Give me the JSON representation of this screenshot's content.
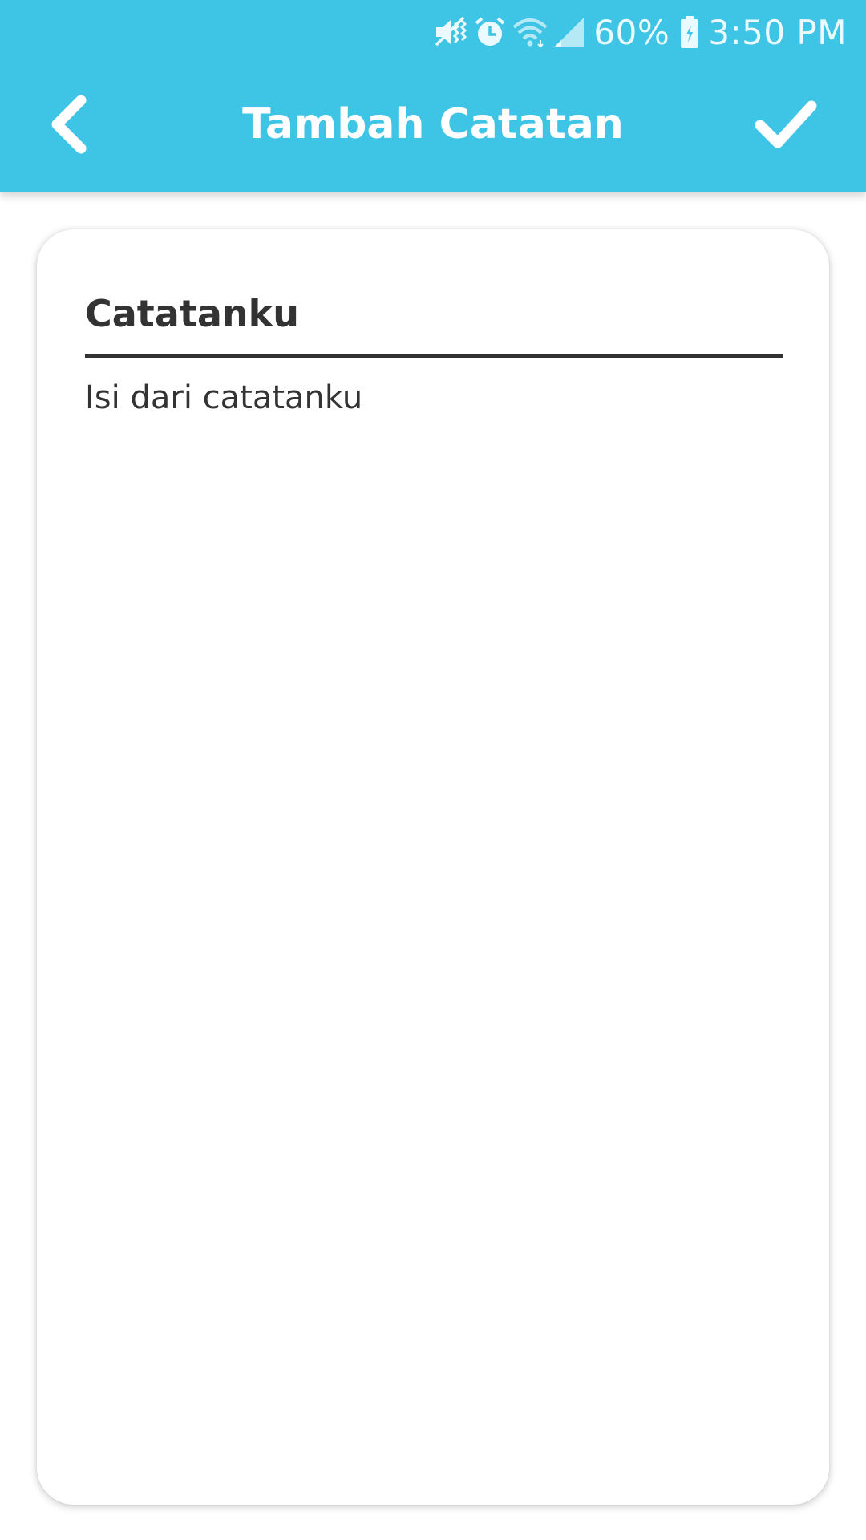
{
  "status_bar": {
    "battery": "60%",
    "time": "3:50 PM",
    "icons": [
      "mute-vibrate-icon",
      "alarm-icon",
      "wifi-icon",
      "cell-signal-icon",
      "battery-charging-icon"
    ]
  },
  "toolbar": {
    "title": "Tambah Catatan",
    "back_icon": "chevron-left-icon",
    "save_icon": "checkmark-icon"
  },
  "note": {
    "title_value": "Catatanku",
    "body_value": "Isi dari catatanku"
  },
  "colors": {
    "header": "#3ec4e5",
    "text": "#333333",
    "background": "#ffffff"
  }
}
